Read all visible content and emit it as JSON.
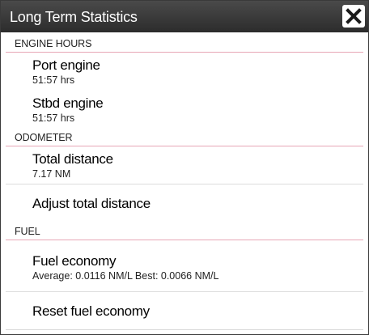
{
  "window": {
    "title": "Long Term Statistics"
  },
  "icons": {
    "close": "close-icon"
  },
  "sections": {
    "engine_hours": {
      "header": "ENGINE HOURS",
      "port": {
        "label": "Port engine",
        "value": "51:57 hrs"
      },
      "stbd": {
        "label": "Stbd engine",
        "value": "51:57 hrs"
      }
    },
    "odometer": {
      "header": "ODOMETER",
      "total": {
        "label": "Total distance",
        "value": "7.17 NM"
      },
      "adjust": {
        "label": "Adjust total distance"
      }
    },
    "fuel": {
      "header": "FUEL",
      "economy": {
        "label": "Fuel economy",
        "value": "Average: 0.0116 NM/L Best: 0.0066 NM/L"
      },
      "reset": {
        "label": "Reset fuel economy"
      }
    }
  },
  "colors": {
    "titlebar": "#2c2c2c",
    "section_divider": "#e7a6b6",
    "item_divider": "#dcdcdc"
  }
}
